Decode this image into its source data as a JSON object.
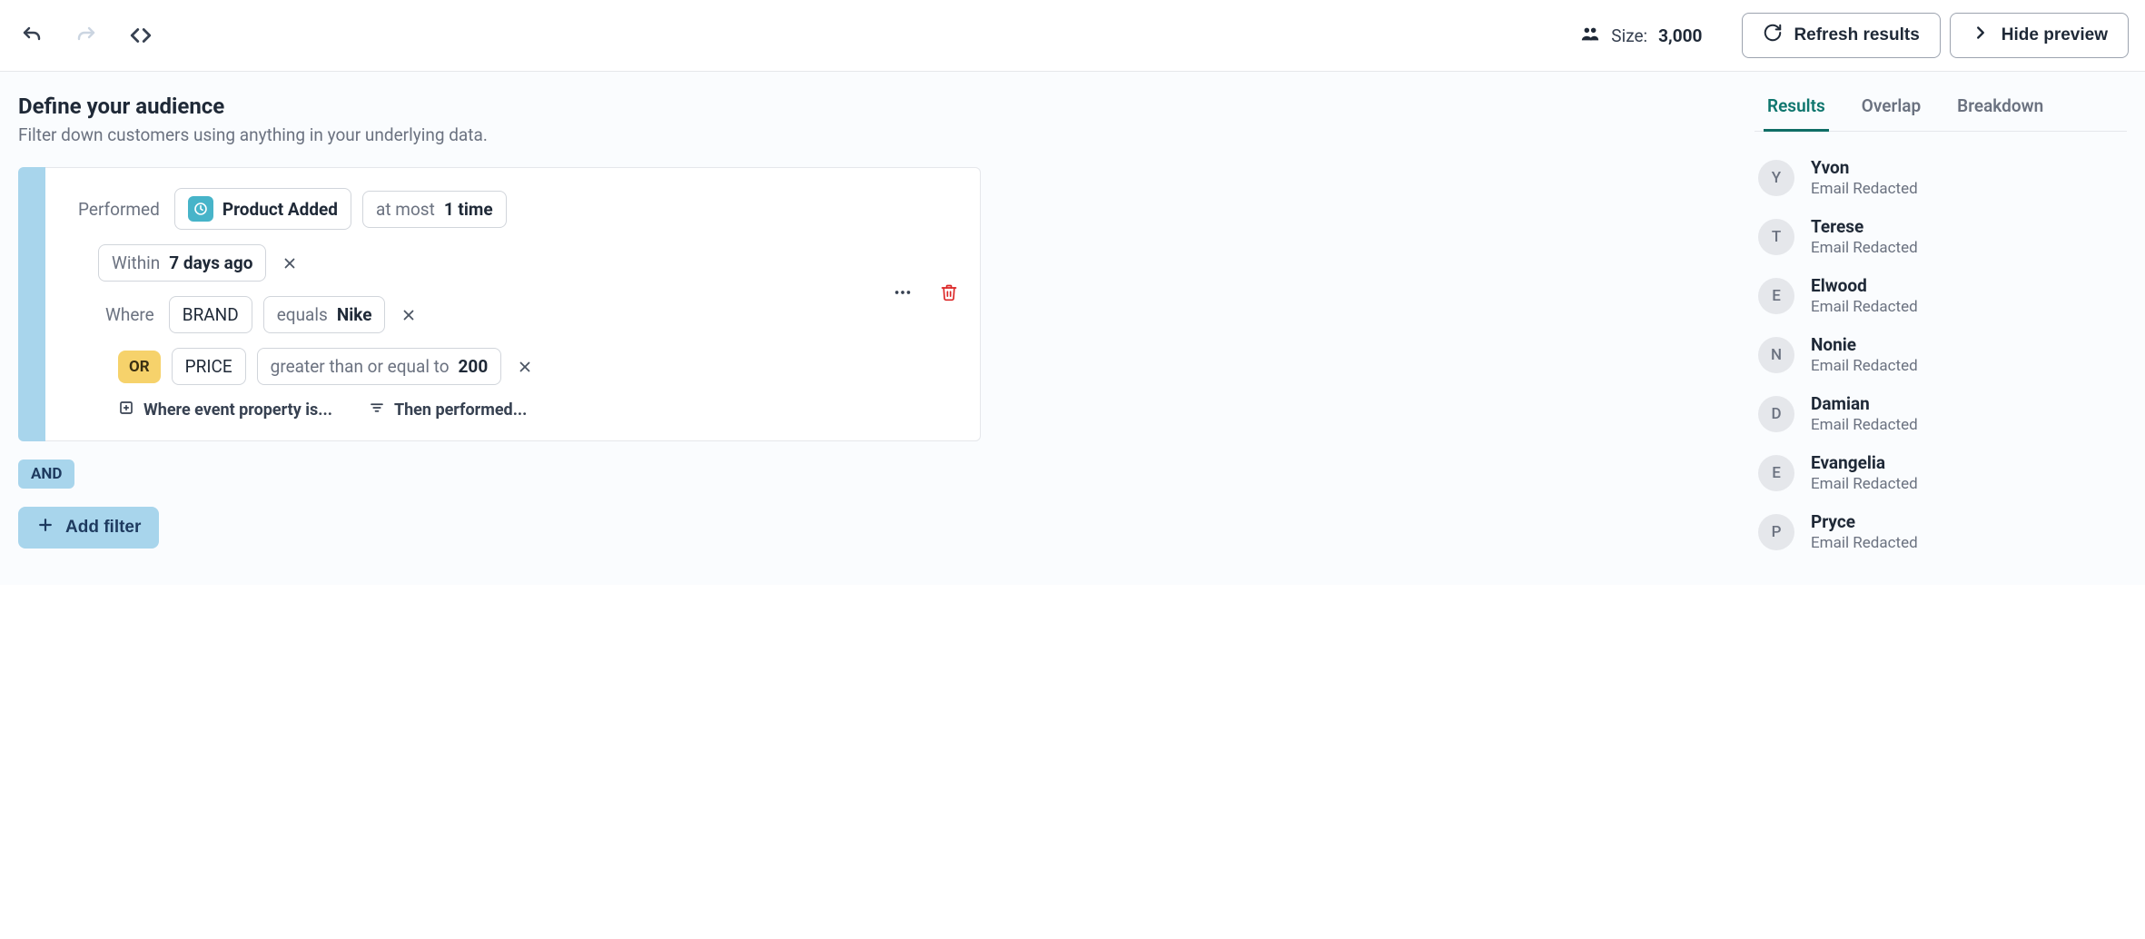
{
  "toolbar": {
    "size_label": "Size:",
    "size_value": "3,000",
    "refresh_label": "Refresh results",
    "hide_preview_label": "Hide preview"
  },
  "header": {
    "title": "Define your audience",
    "subtitle": "Filter down customers using anything in your underlying data."
  },
  "filter": {
    "performed_label": "Performed",
    "event_name": "Product Added",
    "count_prefix": "at most",
    "count_value": "1 time",
    "within_prefix": "Within",
    "within_value": "7 days ago",
    "where_label": "Where",
    "cond1_prop": "BRAND",
    "cond1_op": "equals",
    "cond1_val": "Nike",
    "or_label": "OR",
    "cond2_prop": "PRICE",
    "cond2_op": "greater than or equal to",
    "cond2_val": "200",
    "where_event_prop_label": "Where event property is...",
    "then_performed_label": "Then performed..."
  },
  "logic": {
    "and_label": "AND",
    "add_filter_label": "Add filter"
  },
  "tabs": {
    "results": "Results",
    "overlap": "Overlap",
    "breakdown": "Breakdown"
  },
  "results": [
    {
      "initial": "Y",
      "name": "Yvon",
      "sub": "Email Redacted"
    },
    {
      "initial": "T",
      "name": "Terese",
      "sub": "Email Redacted"
    },
    {
      "initial": "E",
      "name": "Elwood",
      "sub": "Email Redacted"
    },
    {
      "initial": "N",
      "name": "Nonie",
      "sub": "Email Redacted"
    },
    {
      "initial": "D",
      "name": "Damian",
      "sub": "Email Redacted"
    },
    {
      "initial": "E",
      "name": "Evangelia",
      "sub": "Email Redacted"
    },
    {
      "initial": "P",
      "name": "Pryce",
      "sub": "Email Redacted"
    }
  ]
}
